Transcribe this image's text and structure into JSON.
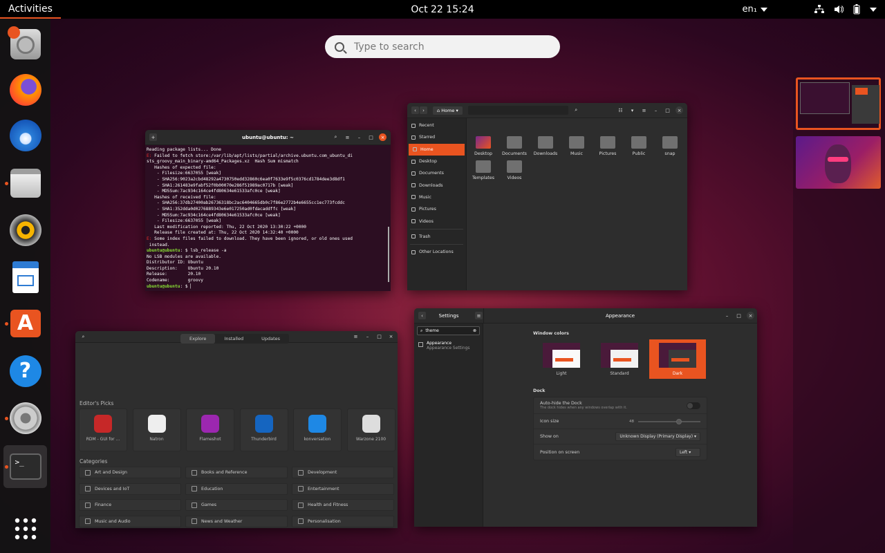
{
  "topbar": {
    "activities": "Activities",
    "clock": "Oct 22  15:24",
    "lang": "en₁"
  },
  "search": {
    "placeholder": "Type to search"
  },
  "dock": {
    "apps": [
      "Ubuntu Installer",
      "Firefox",
      "Thunderbird",
      "Files",
      "Rhythmbox",
      "LibreOffice Writer",
      "Ubuntu Software",
      "Help",
      "Settings",
      "Terminal",
      "Show Applications"
    ]
  },
  "terminal": {
    "title": "ubuntu@ubuntu: ~",
    "lines": [
      {
        "t": "Reading package lists... Done"
      },
      {
        "p": "E:",
        "t": " Failed to fetch store:/var/lib/apt/lists/partial/archive.ubuntu.com_ubuntu_di"
      },
      {
        "t": "sts_groovy_main_binary-amd64_Packages.xz  Hash Sum mismatch"
      },
      {
        "t": "   Hashes of expected file:"
      },
      {
        "t": "    - Filesize:6637055 [weak]"
      },
      {
        "t": "    - SHA256:9023a2cbd48292a4730750edd32860c6ea0f7633e9f5c0376cd1784dee3d8df1"
      },
      {
        "t": "    - SHA1:261483e9fabf52f0b00070e286f51989ac0717b [weak]"
      },
      {
        "t": "    - MD5Sum:7ac934c164ce4fd80634e61533afc0ce [weak]"
      },
      {
        "t": "   Hashes of received file:"
      },
      {
        "t": "    - SHA256:37db27400ab26736318bc2ac6404665db0c7f86e2772b4e6655cc1ec773fcddc"
      },
      {
        "t": "    - SHA1:352dda0d0276889343e6e017250ad0fdacaddffc [weak]"
      },
      {
        "t": "    - MD5Sum:7ac934c164ce4fd80634e61533afc0ce [weak]"
      },
      {
        "t": "    - Filesize:6637055 [weak]"
      },
      {
        "t": "   Last modification reported: Thu, 22 Oct 2020 13:30:22 +0000"
      },
      {
        "t": "   Release file created at: Thu, 22 Oct 2020 14:32:40 +0000"
      },
      {
        "p": "E:",
        "t": " Some index files failed to download. They have been ignored, or old ones used"
      },
      {
        "t": " instead."
      },
      {
        "u": "ubuntu@ubuntu",
        "t": ": $ lsb_release -a"
      },
      {
        "t": "No LSB modules are available."
      },
      {
        "t": "Distributor ID: Ubuntu"
      },
      {
        "t": "Description:    Ubuntu 20.10"
      },
      {
        "t": "Release:        20.10"
      },
      {
        "t": "Codename:       groovy"
      },
      {
        "u": "ubuntu@ubuntu",
        "t": ": $ ▏"
      }
    ]
  },
  "files": {
    "location": "Home",
    "sidebar": [
      "Recent",
      "Starred",
      "Home",
      "Desktop",
      "Documents",
      "Downloads",
      "Music",
      "Pictures",
      "Videos",
      "Trash",
      "Other Locations"
    ],
    "selected": "Home",
    "folders": [
      "Desktop",
      "Documents",
      "Downloads",
      "Music",
      "Pictures",
      "Public",
      "snap",
      "Templates",
      "Videos"
    ]
  },
  "software": {
    "tabs": [
      "Explore",
      "Installed",
      "Updates"
    ],
    "picks_title": "Editor's Picks",
    "picks": [
      "RDM - GUI for ...",
      "Natron",
      "Flameshot",
      "Thunderbird",
      "konversation",
      "Warzone 2100"
    ],
    "categories_title": "Categories",
    "categories": [
      "Art and Design",
      "Books and Reference",
      "Development",
      "Devices and IoT",
      "Education",
      "Entertainment",
      "Finance",
      "Games",
      "Health and Fitness",
      "Music and Audio",
      "News and Weather",
      "Personalisation"
    ]
  },
  "settings": {
    "title": "Settings",
    "panel_title": "Appearance",
    "search_value": "theme",
    "side_item": "Appearance",
    "side_sub": "Appearance Settings",
    "window_colors": "Window colors",
    "themes": [
      "Light",
      "Standard",
      "Dark"
    ],
    "dock_title": "Dock",
    "autohide": "Auto-hide the Dock",
    "autohide_sub": "The dock hides when any windows overlap with it.",
    "icon_size": "Icon size",
    "icon_size_val": "48",
    "show_on": "Show on",
    "show_on_val": "Unknown Display (Primary Display)",
    "position": "Position on screen",
    "position_val": "Left"
  },
  "colors": {
    "accent": "#e95420",
    "dock": "#141414",
    "terminal_bg": "#2c0e22"
  }
}
